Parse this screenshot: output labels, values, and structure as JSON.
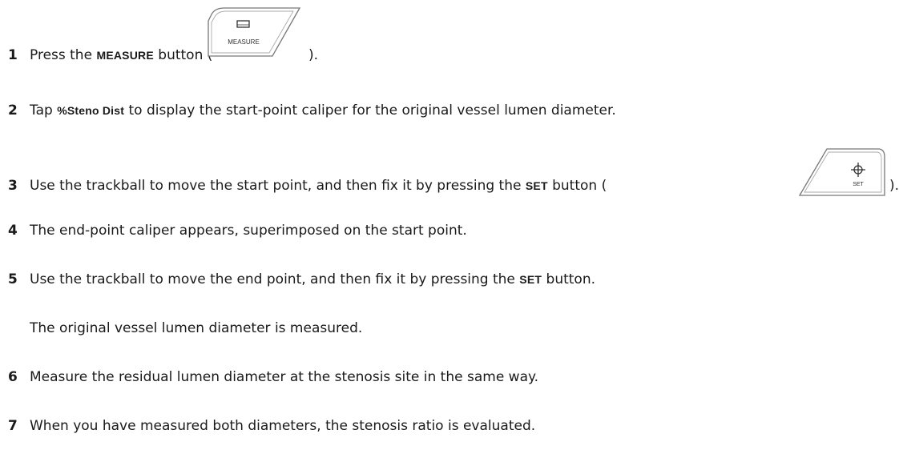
{
  "steps": [
    {
      "num": "1",
      "pre": "Press the ",
      "keyword": "MEASURE",
      "post": " button (",
      "after_icon": ")."
    },
    {
      "num": "2",
      "pre": "Tap ",
      "keyword": "%Steno Dist",
      "post": " to display the start-point caliper for the original vessel lumen diameter."
    },
    {
      "num": "3",
      "pre": "Use the trackball to move the start point, and then fix it by pressing the ",
      "keyword": "SET",
      "post": " button (",
      "after_icon": ")."
    },
    {
      "num": "4",
      "text": "The end-point caliper appears, superimposed on the start point."
    },
    {
      "num": "5",
      "pre": "Use the trackball to move the end point, and then fix it by pressing the ",
      "keyword": "SET",
      "post": " button."
    },
    {
      "note": "The original vessel lumen diameter is measured."
    },
    {
      "num": "6",
      "text": "Measure the residual lumen diameter at the stenosis site in the same way."
    },
    {
      "num": "7",
      "text": "When you have measured both diameters, the stenosis ratio is evaluated."
    }
  ],
  "icons": {
    "measure_button": {
      "label": "MEASURE",
      "icon": "measure-key-icon"
    },
    "set_button": {
      "label": "SET",
      "icon": "crosshair-set-key-icon"
    }
  }
}
